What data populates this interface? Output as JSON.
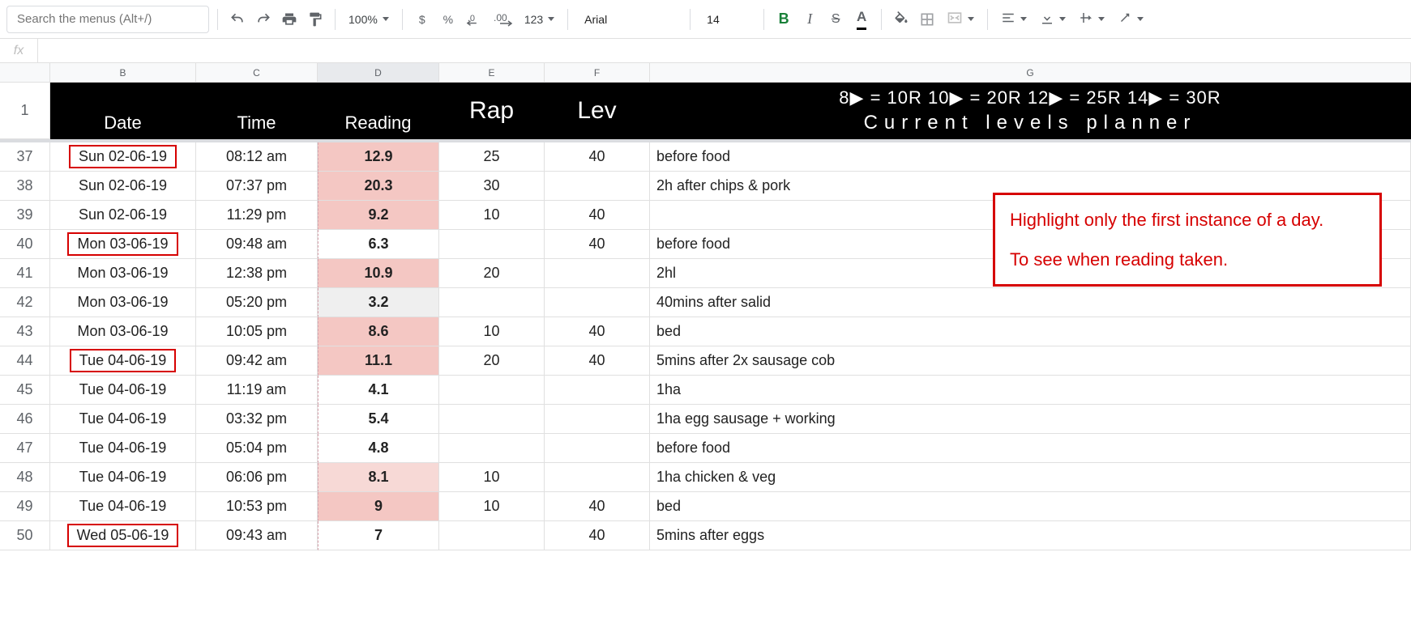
{
  "toolbar": {
    "menu_search_placeholder": "Search the menus (Alt+/)",
    "zoom": "100%",
    "font_name": "Arial",
    "font_size": "14",
    "num_fmt_label_123": "123"
  },
  "columns": [
    "",
    "B",
    "C",
    "D",
    "E",
    "F",
    "G"
  ],
  "headers": {
    "B": "Date",
    "C": "Time",
    "D": "Reading",
    "E": "Rap",
    "F": "Lev",
    "G_top": "8▶ = 10R      10▶ = 20R      12▶ = 25R      14▶ = 30R",
    "G_bottom": "Current levels planner"
  },
  "rows": [
    {
      "n": 37,
      "date": "Sun 02-06-19",
      "time": "08:12 am",
      "reading": "12.9",
      "rap": "25",
      "lev": "40",
      "note": "before food",
      "first": true,
      "shade": "pink"
    },
    {
      "n": 38,
      "date": "Sun 02-06-19",
      "time": "07:37 pm",
      "reading": "20.3",
      "rap": "30",
      "lev": "",
      "note": "2h after chips & pork",
      "first": false,
      "shade": "pink"
    },
    {
      "n": 39,
      "date": "Sun 02-06-19",
      "time": "11:29 pm",
      "reading": "9.2",
      "rap": "10",
      "lev": "40",
      "note": "",
      "first": false,
      "shade": "pink"
    },
    {
      "n": 40,
      "date": "Mon 03-06-19",
      "time": "09:48 am",
      "reading": "6.3",
      "rap": "",
      "lev": "40",
      "note": "before food",
      "first": true,
      "shade": "none"
    },
    {
      "n": 41,
      "date": "Mon 03-06-19",
      "time": "12:38 pm",
      "reading": "10.9",
      "rap": "20",
      "lev": "",
      "note": "2hl",
      "first": false,
      "shade": "pink"
    },
    {
      "n": 42,
      "date": "Mon 03-06-19",
      "time": "05:20 pm",
      "reading": "3.2",
      "rap": "",
      "lev": "",
      "note": "40mins after salid",
      "first": false,
      "shade": "gray"
    },
    {
      "n": 43,
      "date": "Mon 03-06-19",
      "time": "10:05 pm",
      "reading": "8.6",
      "rap": "10",
      "lev": "40",
      "note": "bed",
      "first": false,
      "shade": "pink"
    },
    {
      "n": 44,
      "date": "Tue 04-06-19",
      "time": "09:42 am",
      "reading": "11.1",
      "rap": "20",
      "lev": "40",
      "note": "5mins after 2x sausage cob",
      "first": true,
      "shade": "pink"
    },
    {
      "n": 45,
      "date": "Tue 04-06-19",
      "time": "11:19 am",
      "reading": "4.1",
      "rap": "",
      "lev": "",
      "note": "1ha",
      "first": false,
      "shade": "none"
    },
    {
      "n": 46,
      "date": "Tue 04-06-19",
      "time": "03:32 pm",
      "reading": "5.4",
      "rap": "",
      "lev": "",
      "note": "1ha egg sausage + working",
      "first": false,
      "shade": "none"
    },
    {
      "n": 47,
      "date": "Tue 04-06-19",
      "time": "05:04 pm",
      "reading": "4.8",
      "rap": "",
      "lev": "",
      "note": "before food",
      "first": false,
      "shade": "none"
    },
    {
      "n": 48,
      "date": "Tue 04-06-19",
      "time": "06:06 pm",
      "reading": "8.1",
      "rap": "10",
      "lev": "",
      "note": "1ha chicken & veg",
      "first": false,
      "shade": "lightpink"
    },
    {
      "n": 49,
      "date": "Tue 04-06-19",
      "time": "10:53 pm",
      "reading": "9",
      "rap": "10",
      "lev": "40",
      "note": "bed",
      "first": false,
      "shade": "pink"
    },
    {
      "n": 50,
      "date": "Wed 05-06-19",
      "time": "09:43 am",
      "reading": "7",
      "rap": "",
      "lev": "40",
      "note": "5mins after eggs",
      "first": true,
      "shade": "none"
    }
  ],
  "callout": {
    "line1": "Highlight only the first instance of a day.",
    "line2": "To see when reading taken."
  }
}
